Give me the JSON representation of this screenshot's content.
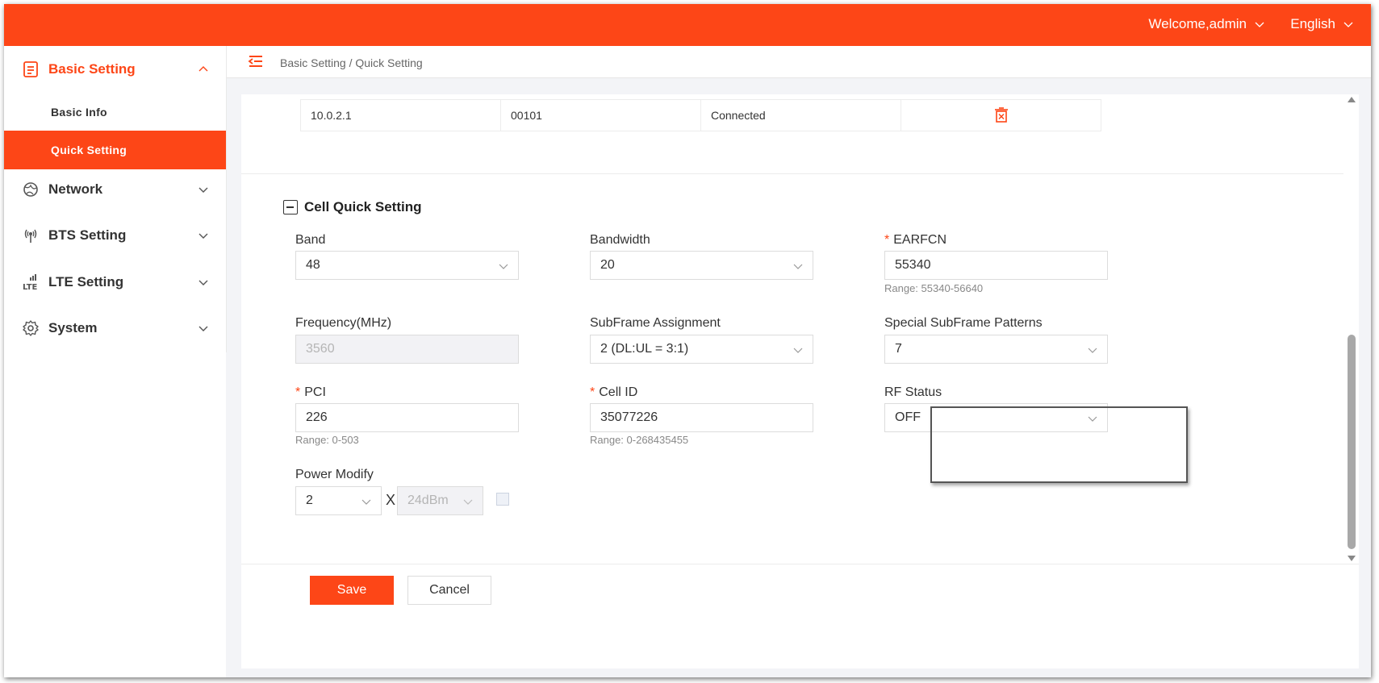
{
  "topbar": {
    "welcome": "Welcome,admin",
    "language": "English"
  },
  "breadcrumb": "Basic Setting / Quick Setting",
  "sidebar": {
    "basic_setting": "Basic Setting",
    "basic_info": "Basic Info",
    "quick_setting": "Quick Setting",
    "network": "Network",
    "bts_setting": "BTS Setting",
    "lte_setting": "LTE Setting",
    "system": "System"
  },
  "peer_row": {
    "ip": "10.0.2.1",
    "plmn": "00101",
    "status": "Connected"
  },
  "section_title": "Cell Quick Setting",
  "fields": {
    "band": {
      "label": "Band",
      "value": "48"
    },
    "bandwidth": {
      "label": "Bandwidth",
      "value": "20"
    },
    "earfcn": {
      "label": "EARFCN",
      "value": "55340",
      "hint": "Range: 55340-56640"
    },
    "frequency": {
      "label": "Frequency(MHz)",
      "value": "3560"
    },
    "subframe": {
      "label": "SubFrame Assignment",
      "value": "2 (DL:UL = 3:1)"
    },
    "special_subframe": {
      "label": "Special SubFrame Patterns",
      "value": "7"
    },
    "pci": {
      "label": "PCI",
      "value": "226",
      "hint": "Range: 0-503"
    },
    "cell_id": {
      "label": "Cell ID",
      "value": "35077226",
      "hint": "Range: 0-268435455"
    },
    "rf_status": {
      "label": "RF Status",
      "value": "OFF"
    },
    "power_modify": {
      "label": "Power Modify",
      "multiplier": "2",
      "cross": "X",
      "power": "24dBm"
    }
  },
  "required_mark": "*",
  "buttons": {
    "save": "Save",
    "cancel": "Cancel"
  },
  "colors": {
    "accent": "#fd4617"
  }
}
